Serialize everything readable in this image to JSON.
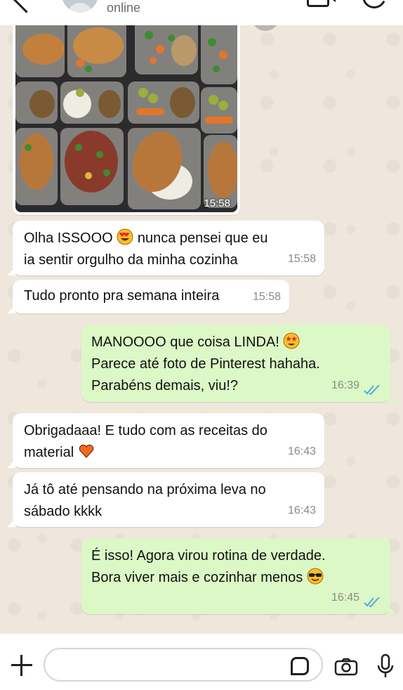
{
  "header": {
    "status": "online"
  },
  "photo_message": {
    "time": "15:58"
  },
  "messages": [
    {
      "direction": "incoming",
      "line1": "Olha ISSOOO ",
      "emoji1": "heart-eyes",
      "line1b": " nunca pensei que eu",
      "line2": "ia sentir orgulho da minha cozinha",
      "time": "15:58"
    },
    {
      "direction": "incoming",
      "text": "Tudo pronto pra semana inteira",
      "time": "15:58"
    },
    {
      "direction": "outgoing",
      "line1": "MANOOOO que coisa LINDA! ",
      "emoji1": "star-eyes",
      "line2": "Parece até foto de Pinterest hahaha.",
      "line3": "Parabéns demais, viu!?",
      "time": "16:39",
      "read": true
    },
    {
      "direction": "incoming",
      "line1": "Obrigadaaa! E tudo com as receitas do",
      "line2": "material ",
      "emoji1": "orange-heart",
      "time": "16:43"
    },
    {
      "direction": "incoming",
      "line1": "Já tô até pensando na próxima leva no",
      "line2": "sábado kkkk",
      "time": "16:43"
    },
    {
      "direction": "outgoing",
      "line1": "É isso! Agora virou rotina de verdade.",
      "line2": "Bora viver mais e cozinhar menos ",
      "emoji1": "sunglasses",
      "time": "16:45",
      "read": true
    }
  ],
  "composer": {
    "input_value": "",
    "placeholder": ""
  },
  "colors": {
    "incoming": "#ffffff",
    "outgoing": "#dcf8c6",
    "read_ticks": "#4fa8e0",
    "wallpaper": "#efe7dc"
  }
}
